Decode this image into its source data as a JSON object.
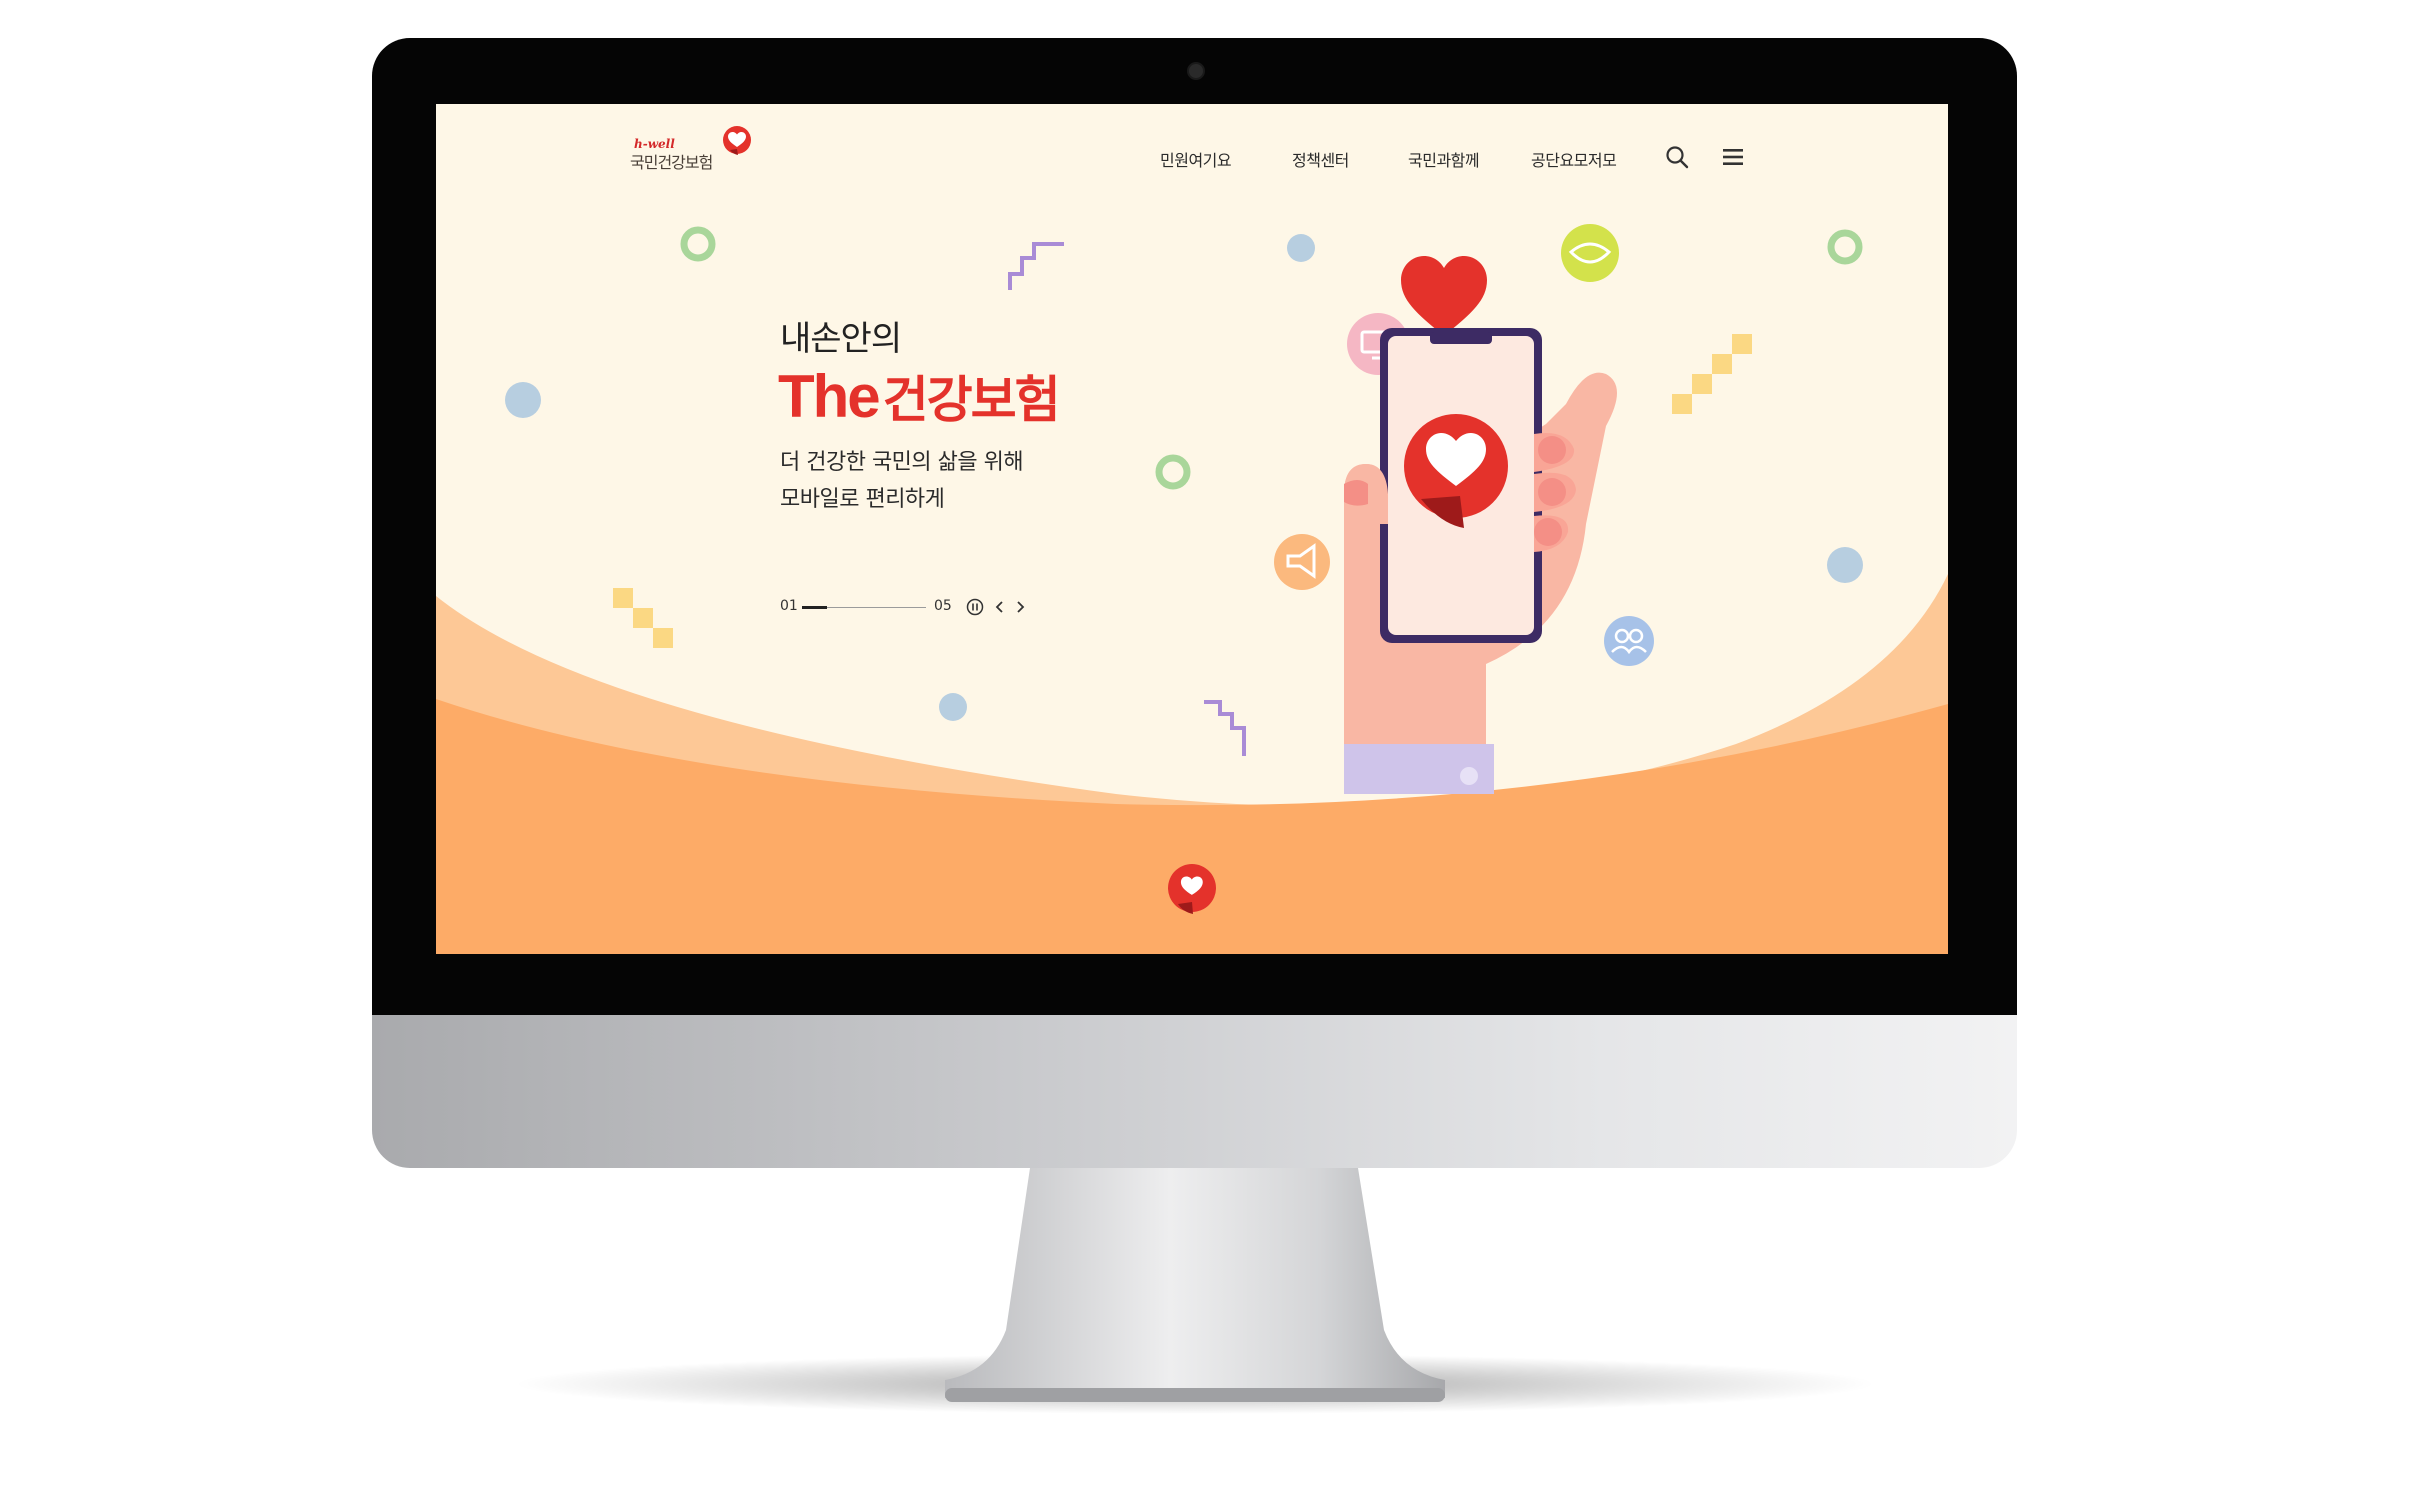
{
  "brand": {
    "tagline": "h-well",
    "name": "국민건강보험"
  },
  "nav": {
    "items": [
      "민원여기요",
      "정책센터",
      "국민과함께",
      "공단요모저모"
    ]
  },
  "hero": {
    "subtitle": "내손안의",
    "title_en": "The",
    "title_ko": "건강보험",
    "desc_line1": "더 건강한 국민의 삶을 위해",
    "desc_line2": "모바일로 편리하게"
  },
  "pager": {
    "start": "01",
    "end": "05",
    "progress": 0.2
  },
  "icons": {
    "search": "search-icon",
    "menu": "hamburger-menu-icon",
    "pause": "pause-icon",
    "prev": "chevron-left-icon",
    "next": "chevron-right-icon"
  },
  "colors": {
    "screen_bg": "#fef7e7",
    "accent_red": "#e4322b",
    "orange": "#fdab67",
    "light_orange": "#fdc896"
  }
}
